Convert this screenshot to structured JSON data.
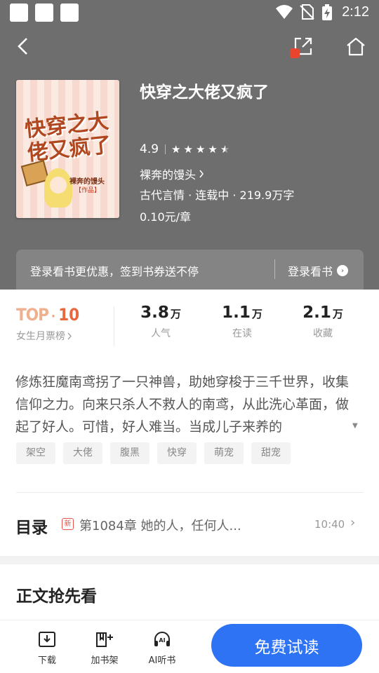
{
  "status_bar": {
    "time": "2:12"
  },
  "book": {
    "title": "快穿之大佬又疯了",
    "rating": "4.9",
    "author": "裸奔的馒头",
    "meta": "古代言情 · 连载中 · 219.9万字",
    "price": "0.10元/章",
    "cover": {
      "title": "快穿之大佬又疯了",
      "author": "裸奔的馒头",
      "tag": "【作品】"
    }
  },
  "login_bar": {
    "text": "登录看书更优惠，签到书券送不停",
    "button": "登录看书"
  },
  "rank": {
    "top": "TOP",
    "num": "10",
    "label": "女生月票榜"
  },
  "stats": [
    {
      "value": "3.8",
      "unit": "万",
      "label": "人气"
    },
    {
      "value": "1.1",
      "unit": "万",
      "label": "在读"
    },
    {
      "value": "2.1",
      "unit": "万",
      "label": "收藏"
    }
  ],
  "intro": "修炼狂魔南鸢拐了一只神兽，助她穿梭于三千世界，收集信仰之力。向来只杀人不救人的南鸢，从此洗心革面，做起了好人。可惜，好人难当。当成儿子来养的",
  "tags": [
    "架空",
    "大佬",
    "腹黑",
    "快穿",
    "萌宠",
    "甜宠"
  ],
  "toc": {
    "title": "目录",
    "new_badge": "新",
    "latest_chapter": "第1084章 她的人，任何人...",
    "time": "10:40"
  },
  "preview": {
    "title": "正文抢先看"
  },
  "bottom_bar": {
    "download": "下载",
    "add_shelf": "加书架",
    "ai_listen": "AI听书",
    "read_button": "免费试读"
  },
  "colors": {
    "header_bg": "#6e6e6e",
    "primary_button": "#2f73f5",
    "rank_accent": "#e8683e"
  }
}
